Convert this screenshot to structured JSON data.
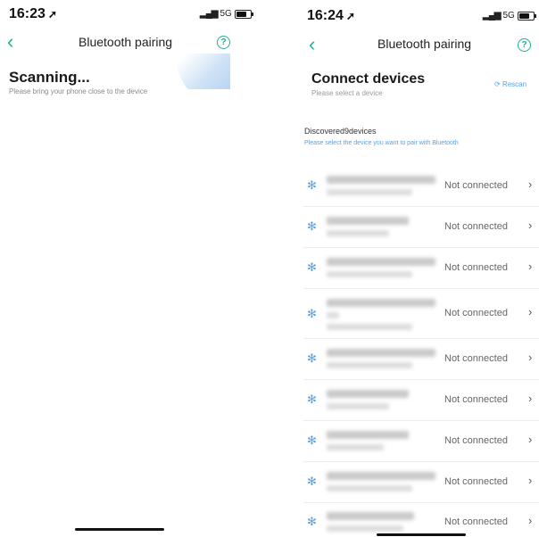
{
  "left": {
    "status": {
      "time": "16:23",
      "network": "5G"
    },
    "nav": {
      "back_icon": "chevron-left-icon",
      "title": "Bluetooth pairing",
      "help_icon": "help-circle-icon",
      "help_glyph": "?"
    },
    "scan": {
      "title": "Scanning...",
      "subtitle": "Please bring your phone close to the device"
    }
  },
  "right": {
    "status": {
      "time": "16:24",
      "network": "5G"
    },
    "nav": {
      "back_icon": "chevron-left-icon",
      "title": "Bluetooth pairing",
      "help_icon": "help-circle-icon",
      "help_glyph": "?"
    },
    "header": {
      "title": "Connect devices",
      "subtitle": "Please select a device",
      "rescan_label": "Rescan"
    },
    "discovered": {
      "title": "Discovered9devices",
      "hint": "Please select the device you want to pair with Bluetooth"
    },
    "devices": [
      {
        "status": "Not connected"
      },
      {
        "status": "Not connected"
      },
      {
        "status": "Not connected"
      },
      {
        "status": "Not connected"
      },
      {
        "status": "Not connected"
      },
      {
        "status": "Not connected"
      },
      {
        "status": "Not connected"
      },
      {
        "status": "Not connected"
      },
      {
        "status": "Not connected"
      }
    ]
  },
  "colors": {
    "accent_green": "#1bb394",
    "accent_blue": "#5aa0e6",
    "status_gray": "#666666"
  }
}
